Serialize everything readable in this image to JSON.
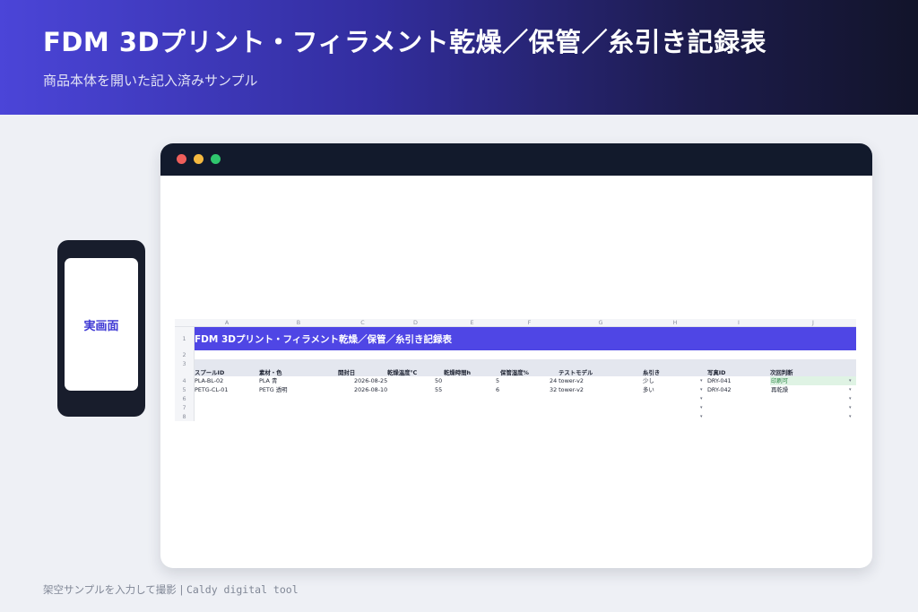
{
  "header": {
    "title": "FDM 3Dプリント・フィラメント乾燥／保管／糸引き記録表",
    "subtitle": "商品本体を開いた記入済みサンプル"
  },
  "phone": {
    "label": "実画面"
  },
  "sheet": {
    "columns": [
      "A",
      "B",
      "C",
      "D",
      "E",
      "F",
      "G",
      "H",
      "I",
      "J"
    ],
    "row_numbers": [
      "1",
      "2",
      "3",
      "4",
      "5",
      "6",
      "7",
      "8"
    ],
    "title": "FDM 3Dプリント・フィラメント乾燥／保管／糸引き記録表",
    "headers": [
      "スプールID",
      "素材・色",
      "開封日",
      "乾燥温度℃",
      "乾燥時間h",
      "保管湿度%",
      "テストモデル",
      "糸引き",
      "写真ID",
      "次回判断"
    ],
    "rows": [
      [
        "PLA-BL-02",
        "PLA 青",
        "2026-08-25",
        "50",
        "5",
        "24 tower-v2",
        "少し",
        "DRY-041",
        "印刷可"
      ],
      [
        "PETG-CL-01",
        "PETG 透明",
        "2026-08-10",
        "55",
        "6",
        "32 tower-v2",
        "多い",
        "DRY-042",
        "再乾燥"
      ]
    ],
    "dropdown_arrow": "▾"
  },
  "footer": {
    "text_jp": "架空サンプルを入力して撮影",
    "separator": "|",
    "brand": "Caldy digital tool"
  },
  "colors": {
    "header_start": "#4b45d8",
    "header_end": "#12142a",
    "title_row": "#4f46e5",
    "accent_green": "#2f8a48"
  }
}
